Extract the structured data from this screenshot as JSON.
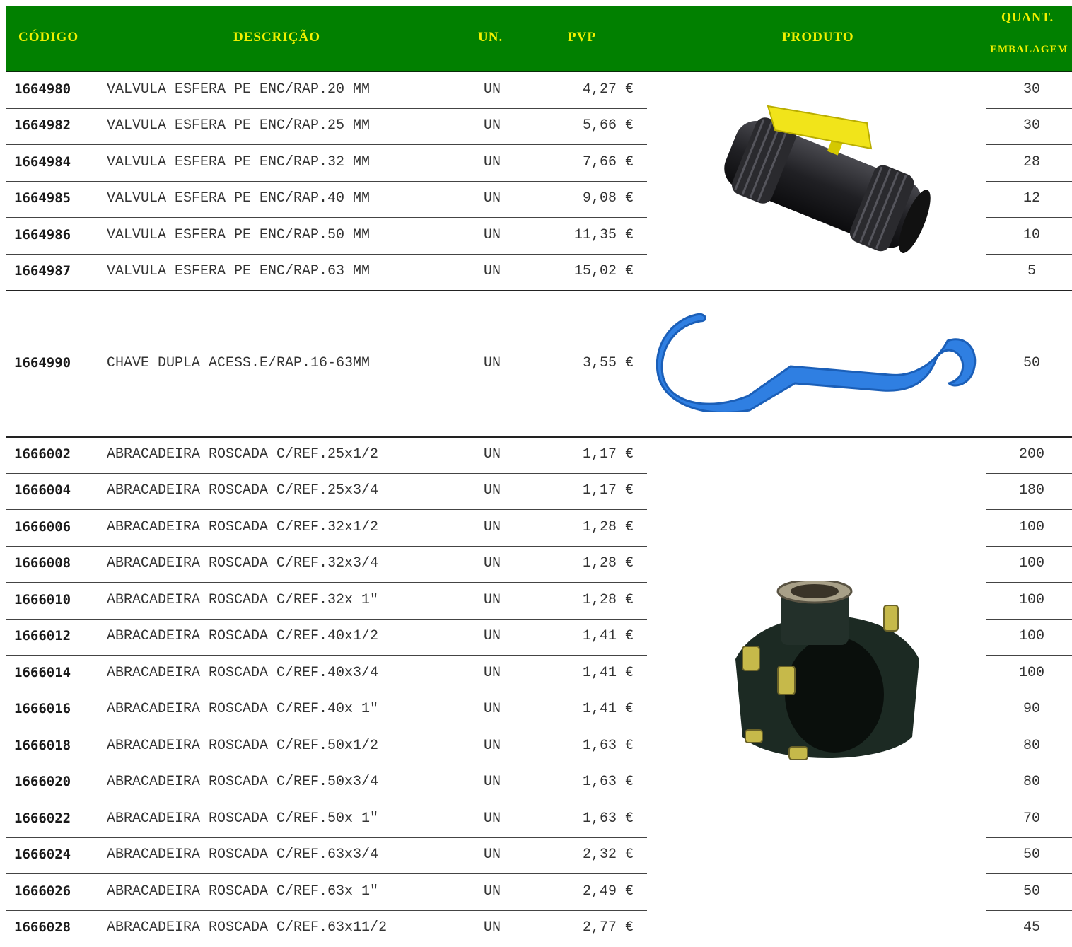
{
  "header": {
    "code": "CÓDIGO",
    "desc": "DESCRIÇÃO",
    "un": "UN.",
    "pvp": "PVP",
    "product": "PRODUTO",
    "qty_line1": "QUANT.",
    "qty_line2": "EMBALAGEM"
  },
  "groups": [
    {
      "product_icon": "ball-valve-image",
      "rows": [
        {
          "code": "1664980",
          "desc": "VALVULA ESFERA PE ENC/RAP.20 MM",
          "un": "UN",
          "pvp": "4,27 €",
          "qty": "30"
        },
        {
          "code": "1664982",
          "desc": "VALVULA ESFERA PE ENC/RAP.25 MM",
          "un": "UN",
          "pvp": "5,66 €",
          "qty": "30"
        },
        {
          "code": "1664984",
          "desc": "VALVULA ESFERA PE ENC/RAP.32 MM",
          "un": "UN",
          "pvp": "7,66 €",
          "qty": "28"
        },
        {
          "code": "1664985",
          "desc": "VALVULA ESFERA PE ENC/RAP.40 MM",
          "un": "UN",
          "pvp": "9,08 €",
          "qty": "12"
        },
        {
          "code": "1664986",
          "desc": "VALVULA ESFERA PE ENC/RAP.50 MM",
          "un": "UN",
          "pvp": "11,35 €",
          "qty": "10"
        },
        {
          "code": "1664987",
          "desc": "VALVULA ESFERA PE ENC/RAP.63 MM",
          "un": "UN",
          "pvp": "15,02 €",
          "qty": "5"
        }
      ]
    },
    {
      "product_icon": "double-wrench-image",
      "rows": [
        {
          "code": "1664990",
          "desc": "CHAVE DUPLA ACESS.E/RAP.16-63MM",
          "un": "UN",
          "pvp": "3,55 €",
          "qty": "50"
        }
      ]
    },
    {
      "product_icon": "clamp-saddle-image",
      "rows": [
        {
          "code": "1666002",
          "desc": "ABRACADEIRA ROSCADA C/REF.25x1/2",
          "un": "UN",
          "pvp": "1,17 €",
          "qty": "200"
        },
        {
          "code": "1666004",
          "desc": "ABRACADEIRA ROSCADA C/REF.25x3/4",
          "un": "UN",
          "pvp": "1,17 €",
          "qty": "180"
        },
        {
          "code": "1666006",
          "desc": "ABRACADEIRA ROSCADA C/REF.32x1/2",
          "un": "UN",
          "pvp": "1,28 €",
          "qty": "100"
        },
        {
          "code": "1666008",
          "desc": "ABRACADEIRA ROSCADA C/REF.32x3/4",
          "un": "UN",
          "pvp": "1,28 €",
          "qty": "100"
        },
        {
          "code": "1666010",
          "desc": "ABRACADEIRA ROSCADA C/REF.32x 1\"",
          "un": "UN",
          "pvp": "1,28 €",
          "qty": "100"
        },
        {
          "code": "1666012",
          "desc": "ABRACADEIRA ROSCADA C/REF.40x1/2",
          "un": "UN",
          "pvp": "1,41 €",
          "qty": "100"
        },
        {
          "code": "1666014",
          "desc": "ABRACADEIRA ROSCADA C/REF.40x3/4",
          "un": "UN",
          "pvp": "1,41 €",
          "qty": "100"
        },
        {
          "code": "1666016",
          "desc": "ABRACADEIRA ROSCADA C/REF.40x 1\"",
          "un": "UN",
          "pvp": "1,41 €",
          "qty": "90"
        },
        {
          "code": "1666018",
          "desc": "ABRACADEIRA ROSCADA C/REF.50x1/2",
          "un": "UN",
          "pvp": "1,63 €",
          "qty": "80"
        },
        {
          "code": "1666020",
          "desc": "ABRACADEIRA ROSCADA C/REF.50x3/4",
          "un": "UN",
          "pvp": "1,63 €",
          "qty": "80"
        },
        {
          "code": "1666022",
          "desc": "ABRACADEIRA ROSCADA C/REF.50x 1\"",
          "un": "UN",
          "pvp": "1,63 €",
          "qty": "70"
        },
        {
          "code": "1666024",
          "desc": "ABRACADEIRA ROSCADA C/REF.63x3/4",
          "un": "UN",
          "pvp": "2,32 €",
          "qty": "50"
        },
        {
          "code": "1666026",
          "desc": "ABRACADEIRA ROSCADA C/REF.63x 1\"",
          "un": "UN",
          "pvp": "2,49 €",
          "qty": "50"
        },
        {
          "code": "1666028",
          "desc": "ABRACADEIRA ROSCADA C/REF.63x11/2",
          "un": "UN",
          "pvp": "2,77 €",
          "qty": "45"
        }
      ]
    }
  ]
}
